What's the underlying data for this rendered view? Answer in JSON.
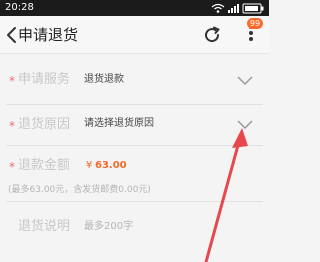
{
  "status_bar": {
    "time": "20:28"
  },
  "nav": {
    "title": "申请退货",
    "badge": "99"
  },
  "form": {
    "service": {
      "required": "*",
      "label": "申请服务",
      "value": "退货退款"
    },
    "reason": {
      "required": "*",
      "label": "退货原因",
      "value": "请选择退货原因"
    },
    "amount": {
      "required": "*",
      "label": "退款金额",
      "currency": "¥",
      "value": "63.00",
      "hint": "(最多63.00元，含发货邮费0.00元)"
    },
    "note": {
      "label": "退货说明",
      "placeholder": "最多200字"
    }
  },
  "colors": {
    "accent": "#ef6b2a",
    "annotation": "#e8474f"
  }
}
